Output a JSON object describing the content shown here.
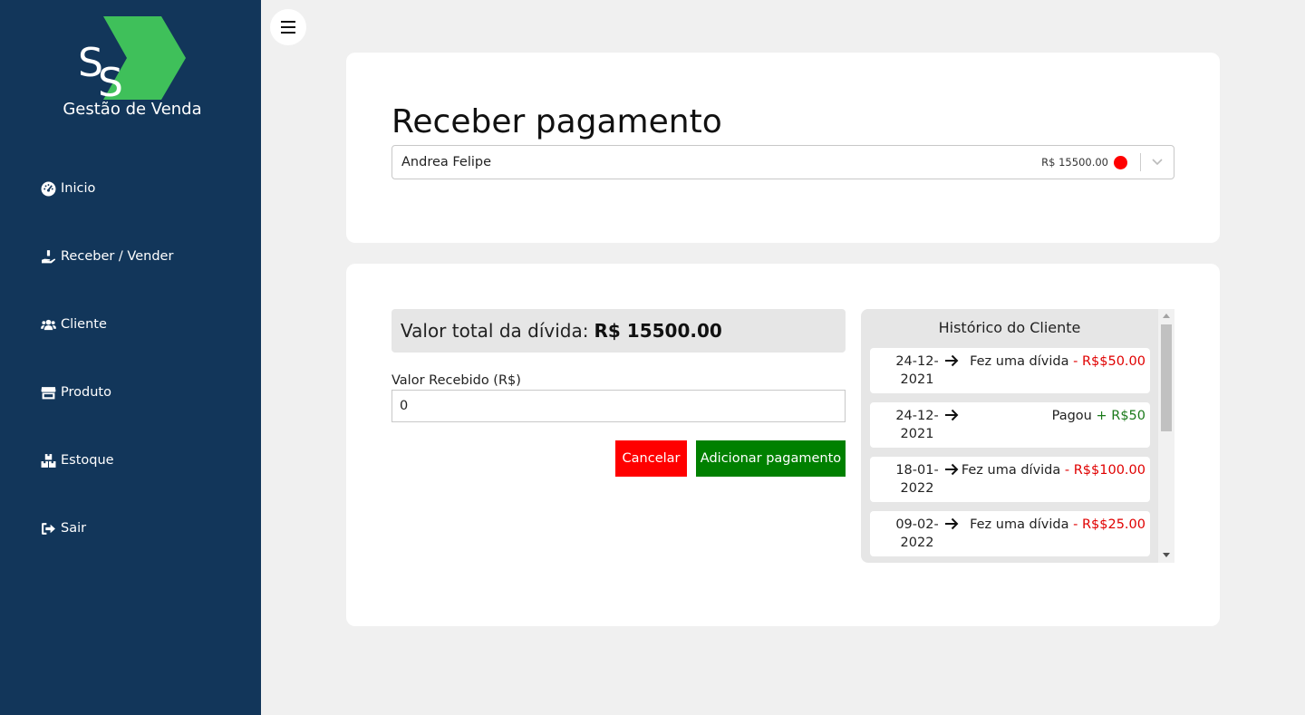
{
  "sidebar": {
    "logo_text": "Gestão de Venda",
    "items": [
      {
        "label": "Inicio",
        "icon": "dashboard-gauge-icon"
      },
      {
        "label": "Receber / Vender",
        "icon": "hand-holding-icon"
      },
      {
        "label": "Cliente",
        "icon": "users-icon"
      },
      {
        "label": "Produto",
        "icon": "store-icon"
      },
      {
        "label": "Estoque",
        "icon": "boxes-icon"
      },
      {
        "label": "Sair",
        "icon": "sign-out-icon"
      }
    ]
  },
  "menu_toggle_icon": "hamburger-menu-icon",
  "header": {
    "title": "Receber pagamento",
    "client_select": {
      "name": "Andrea Felipe",
      "amount": "R$ 15500.00",
      "status_color": "#ff0000"
    }
  },
  "payment": {
    "total_label": "Valor total da dívida:",
    "total_value": "R$ 15500.00",
    "received_label": "Valor Recebido (R$)",
    "received_value": "0",
    "cancel_label": "Cancelar",
    "add_label": "Adicionar pagamento"
  },
  "history": {
    "title": "Histórico do Cliente",
    "entries": [
      {
        "date_line1": "24-12-",
        "date_line2": "2021",
        "desc": "Fez uma dívida",
        "amount": " - R$$50.00",
        "type": "debt"
      },
      {
        "date_line1": "24-12-",
        "date_line2": "2021",
        "desc": "Pagou",
        "amount": " + R$50",
        "type": "payment"
      },
      {
        "date_line1": "18-01-",
        "date_line2": "2022",
        "desc": "Fez uma dívida",
        "amount": " - R$$100.00",
        "type": "debt"
      },
      {
        "date_line1": "09-02-",
        "date_line2": "2022",
        "desc": "Fez uma dívida",
        "amount": " - R$$25.00",
        "type": "debt"
      }
    ]
  },
  "colors": {
    "sidebar_bg": "#12365a",
    "logo_green": "#3fc05a",
    "cancel_red": "#ff0000",
    "add_green": "#008000",
    "debt_red": "#e00000",
    "payment_green": "#1a7a1a"
  }
}
